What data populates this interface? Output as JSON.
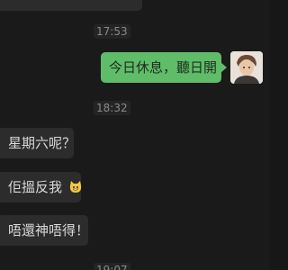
{
  "conversation": {
    "timestamps": [
      "17:53",
      "18:32",
      "19:07"
    ],
    "outgoing": {
      "text": "今日休息，聽日開"
    },
    "incoming": [
      {
        "text": "星期六呢？"
      },
      {
        "text": "佢搵反我",
        "emoji": "grinning-cat-emoji"
      },
      {
        "text": "唔還神唔得！"
      }
    ]
  },
  "colors": {
    "background": "#1a1a1a",
    "incoming_bubble": "#2c2c2c",
    "outgoing_bubble": "#5fbd6a"
  }
}
